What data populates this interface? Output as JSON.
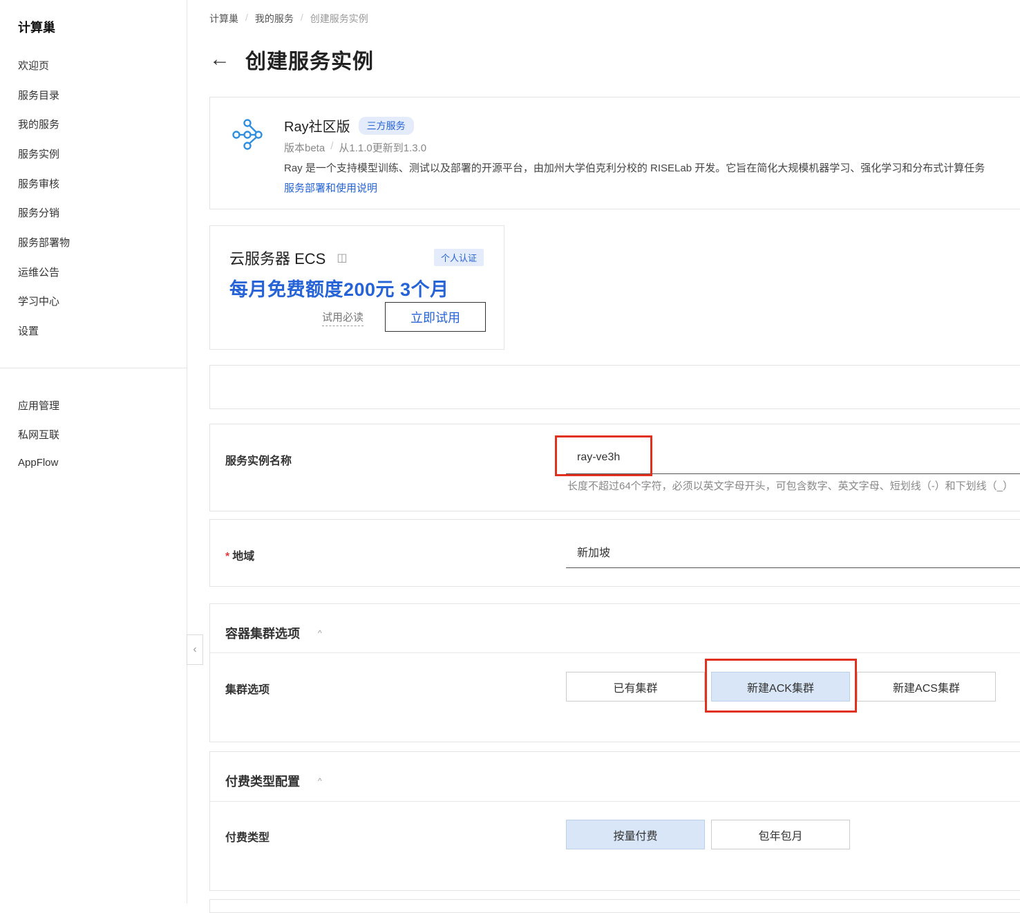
{
  "sidebar": {
    "brand": "计算巢",
    "items": [
      "欢迎页",
      "服务目录",
      "我的服务",
      "服务实例",
      "服务审核",
      "服务分销",
      "服务部署物",
      "运维公告",
      "学习中心",
      "设置"
    ],
    "items2": [
      "应用管理",
      "私网互联",
      "AppFlow"
    ],
    "collapse_icon": "‹"
  },
  "breadcrumb": [
    "计算巢",
    "我的服务",
    "创建服务实例"
  ],
  "page": {
    "back_icon": "←",
    "title": "创建服务实例"
  },
  "service": {
    "name": "Ray社区版",
    "tag": "三方服务",
    "version": "版本beta",
    "update": "从1.1.0更新到1.3.0",
    "description": "Ray 是一个支持模型训练、测试以及部署的开源平台，由加州大学伯克利分校的 RISELab 开发。它旨在简化大规模机器学习、强化学习和分布式计算任务",
    "link": "服务部署和使用说明",
    "icon": "workflow-nodes-icon"
  },
  "ecs_promo": {
    "title": "云服务器 ECS",
    "book_icon": "◫",
    "tag": "个人认证",
    "promo": "每月免费额度200元 3个月",
    "read": "试用必读",
    "try_button": "立即试用"
  },
  "form": {
    "instance_name": {
      "label": "服务实例名称",
      "value": "ray-ve3h",
      "hint": "长度不超过64个字符，必须以英文字母开头，可包含数字、英文字母、短划线（-）和下划线（_）"
    },
    "region": {
      "required": "*",
      "label": "地域",
      "value": "新加坡"
    },
    "cluster_section": {
      "title": "容器集群选项",
      "caret": "^",
      "label": "集群选项",
      "options": [
        "已有集群",
        "新建ACK集群",
        "新建ACS集群"
      ],
      "selected": "新建ACK集群"
    },
    "billing_section": {
      "title": "付费类型配置",
      "caret": "^",
      "label": "付费类型",
      "options": [
        "按量付费",
        "包年包月"
      ],
      "selected": "按量付费"
    }
  },
  "colors": {
    "accent": "#2563d6",
    "highlight": "#e0301e",
    "selected_bg": "#d9e6f7"
  }
}
